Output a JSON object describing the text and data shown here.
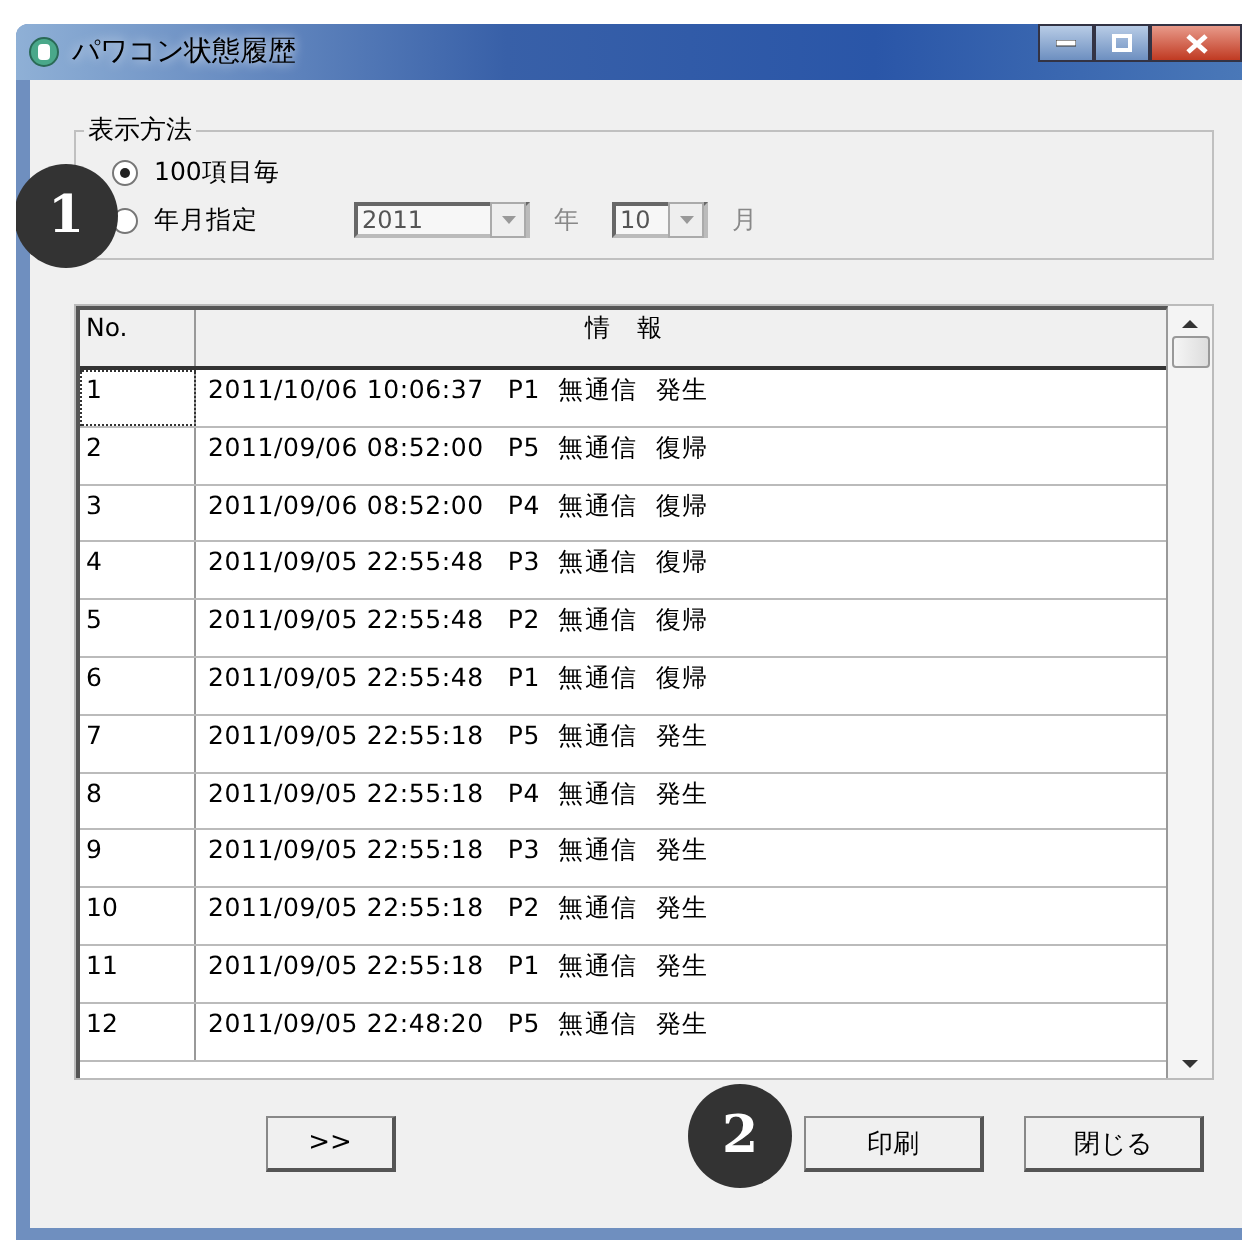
{
  "window": {
    "title": "パワコン状態履歴"
  },
  "display_mode": {
    "legend": "表示方法",
    "options": [
      {
        "label": "100項目毎",
        "selected": true
      },
      {
        "label": "年月指定",
        "selected": false
      }
    ],
    "year": {
      "value": "2011",
      "unit": "年"
    },
    "month": {
      "value": "10",
      "unit": "月"
    }
  },
  "table": {
    "columns": [
      "No.",
      "情　報"
    ],
    "rows": [
      {
        "no": "1",
        "datetime": "2011/10/06 10:06:37",
        "unit": "P1",
        "event": "無通信",
        "state": "発生",
        "focused": true
      },
      {
        "no": "2",
        "datetime": "2011/09/06 08:52:00",
        "unit": "P5",
        "event": "無通信",
        "state": "復帰",
        "focused": false
      },
      {
        "no": "3",
        "datetime": "2011/09/06 08:52:00",
        "unit": "P4",
        "event": "無通信",
        "state": "復帰",
        "focused": false
      },
      {
        "no": "4",
        "datetime": "2011/09/05 22:55:48",
        "unit": "P3",
        "event": "無通信",
        "state": "復帰",
        "focused": false
      },
      {
        "no": "5",
        "datetime": "2011/09/05 22:55:48",
        "unit": "P2",
        "event": "無通信",
        "state": "復帰",
        "focused": false
      },
      {
        "no": "6",
        "datetime": "2011/09/05 22:55:48",
        "unit": "P1",
        "event": "無通信",
        "state": "復帰",
        "focused": false
      },
      {
        "no": "7",
        "datetime": "2011/09/05 22:55:18",
        "unit": "P5",
        "event": "無通信",
        "state": "発生",
        "focused": false
      },
      {
        "no": "8",
        "datetime": "2011/09/05 22:55:18",
        "unit": "P4",
        "event": "無通信",
        "state": "発生",
        "focused": false
      },
      {
        "no": "9",
        "datetime": "2011/09/05 22:55:18",
        "unit": "P3",
        "event": "無通信",
        "state": "発生",
        "focused": false
      },
      {
        "no": "10",
        "datetime": "2011/09/05 22:55:18",
        "unit": "P2",
        "event": "無通信",
        "state": "発生",
        "focused": false
      },
      {
        "no": "11",
        "datetime": "2011/09/05 22:55:18",
        "unit": "P1",
        "event": "無通信",
        "state": "発生",
        "focused": false
      },
      {
        "no": "12",
        "datetime": "2011/09/05 22:48:20",
        "unit": "P5",
        "event": "無通信",
        "state": "発生",
        "focused": false
      }
    ]
  },
  "buttons": [
    {
      "label": ">>"
    },
    {
      "label": "印刷"
    },
    {
      "label": "閉じる"
    }
  ],
  "callouts": [
    "1",
    "2"
  ]
}
